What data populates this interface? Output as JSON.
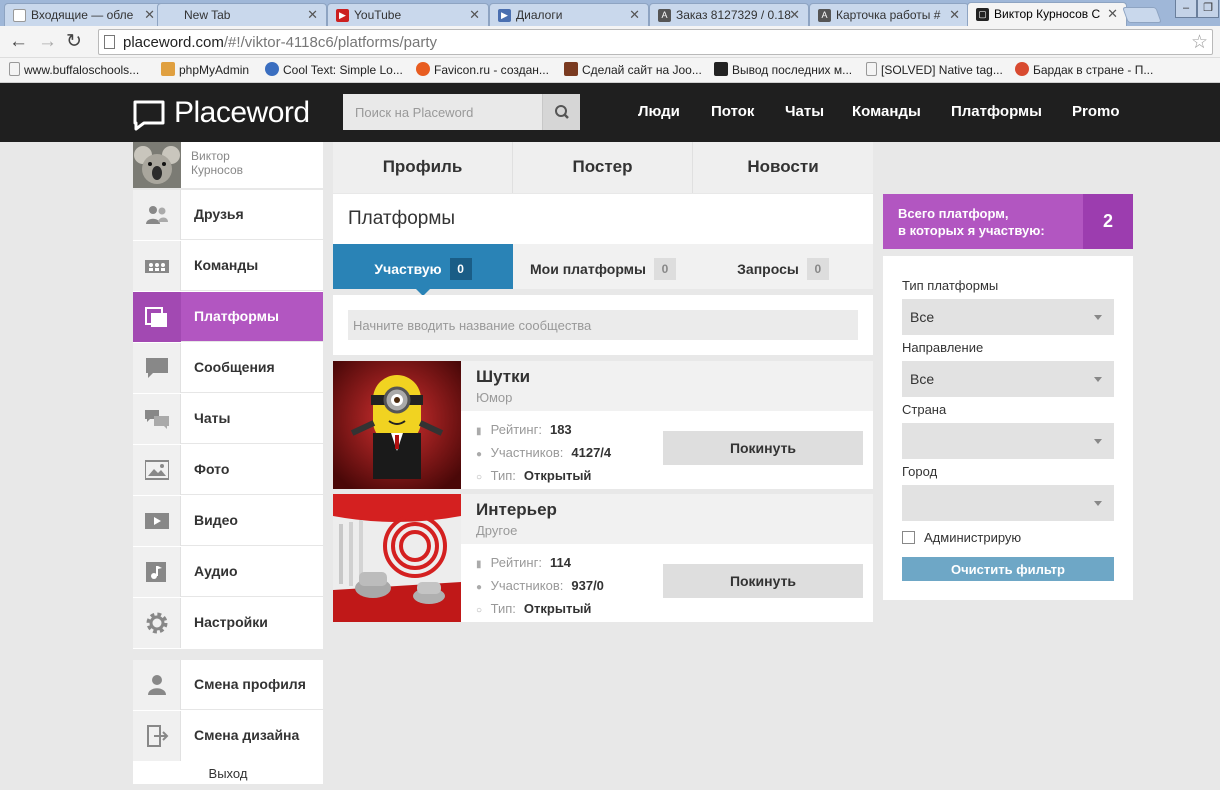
{
  "browser": {
    "tabs": [
      {
        "title": "Входящие — обле",
        "color": "#c0c0c0"
      },
      {
        "title": "New Tab",
        "color": "#c0c0c0"
      },
      {
        "title": "YouTube",
        "color": "#cc2020"
      },
      {
        "title": "Диалоги",
        "color": "#4a6fb0"
      },
      {
        "title": "Заказ 8127329 / 0.18",
        "color": "#555555"
      },
      {
        "title": "Карточка работы #",
        "color": "#555555"
      },
      {
        "title": "Виктор Курносов С",
        "color": "#222222"
      }
    ],
    "url_host": "placeword.com",
    "url_path": "/#!/viktor-4118c6/platforms/party",
    "bookmarks": [
      "www.buffaloschools...",
      "phpMyAdmin",
      "Cool Text: Simple Lo...",
      "Favicon.ru - создан...",
      "Сделай сайт на Joo...",
      "Вывод последних м...",
      "[SOLVED] Native tag...",
      "Бардак в стране - П..."
    ]
  },
  "header": {
    "logo": "Placeword",
    "search_placeholder": "Поиск на Placeword",
    "nav": [
      "Люди",
      "Поток",
      "Чаты",
      "Команды",
      "Платформы",
      "Promo"
    ]
  },
  "profile": {
    "name_line1": "Виктор",
    "name_line2": "Курносов"
  },
  "sidebar": {
    "items": [
      {
        "label": "Друзья",
        "icon": "friends-icon"
      },
      {
        "label": "Команды",
        "icon": "teams-icon"
      },
      {
        "label": "Платформы",
        "icon": "platforms-icon",
        "active": true
      },
      {
        "label": "Сообщения",
        "icon": "messages-icon"
      },
      {
        "label": "Чаты",
        "icon": "chats-icon"
      },
      {
        "label": "Фото",
        "icon": "photo-icon"
      },
      {
        "label": "Видео",
        "icon": "video-icon"
      },
      {
        "label": "Аудио",
        "icon": "audio-icon"
      },
      {
        "label": "Настройки",
        "icon": "gear-icon"
      }
    ],
    "extra": [
      {
        "label": "Смена профиля",
        "icon": "profile-switch-icon"
      },
      {
        "label": "Смена дизайна",
        "icon": "design-switch-icon"
      }
    ],
    "logout": "Выход"
  },
  "main": {
    "profile_tabs": [
      "Профиль",
      "Постер",
      "Новости"
    ],
    "title": "Платформы",
    "subtabs": [
      {
        "label": "Участвую",
        "count": "0"
      },
      {
        "label": "Мои платформы",
        "count": "0"
      },
      {
        "label": "Запросы",
        "count": "0"
      }
    ],
    "filter_placeholder": "Начните вводить название сообщества",
    "rating_label": "Рейтинг:",
    "members_label": "Участников:",
    "type_label": "Тип:",
    "leave_label": "Покинуть",
    "platforms": [
      {
        "name": "Шутки",
        "category": "Юмор",
        "rating": "183",
        "members": "4127/4",
        "type": "Открытый"
      },
      {
        "name": "Интерьер",
        "category": "Другое",
        "rating": "114",
        "members": "937/0",
        "type": "Открытый"
      }
    ]
  },
  "right": {
    "total_text_line1": "Всего платформ,",
    "total_text_line2": "в которых я участвую:",
    "total_count": "2",
    "platform_type_label": "Тип платформы",
    "platform_type_value": "Все",
    "direction_label": "Направление",
    "direction_value": "Все",
    "country_label": "Страна",
    "country_value": "",
    "city_label": "Город",
    "city_value": "",
    "admin_label": "Администрирую",
    "clear_label": "Очистить фильтр"
  },
  "colors": {
    "accent_purple": "#b256c1",
    "accent_blue": "#2a83b6",
    "header_dark": "#1f1f1f"
  }
}
